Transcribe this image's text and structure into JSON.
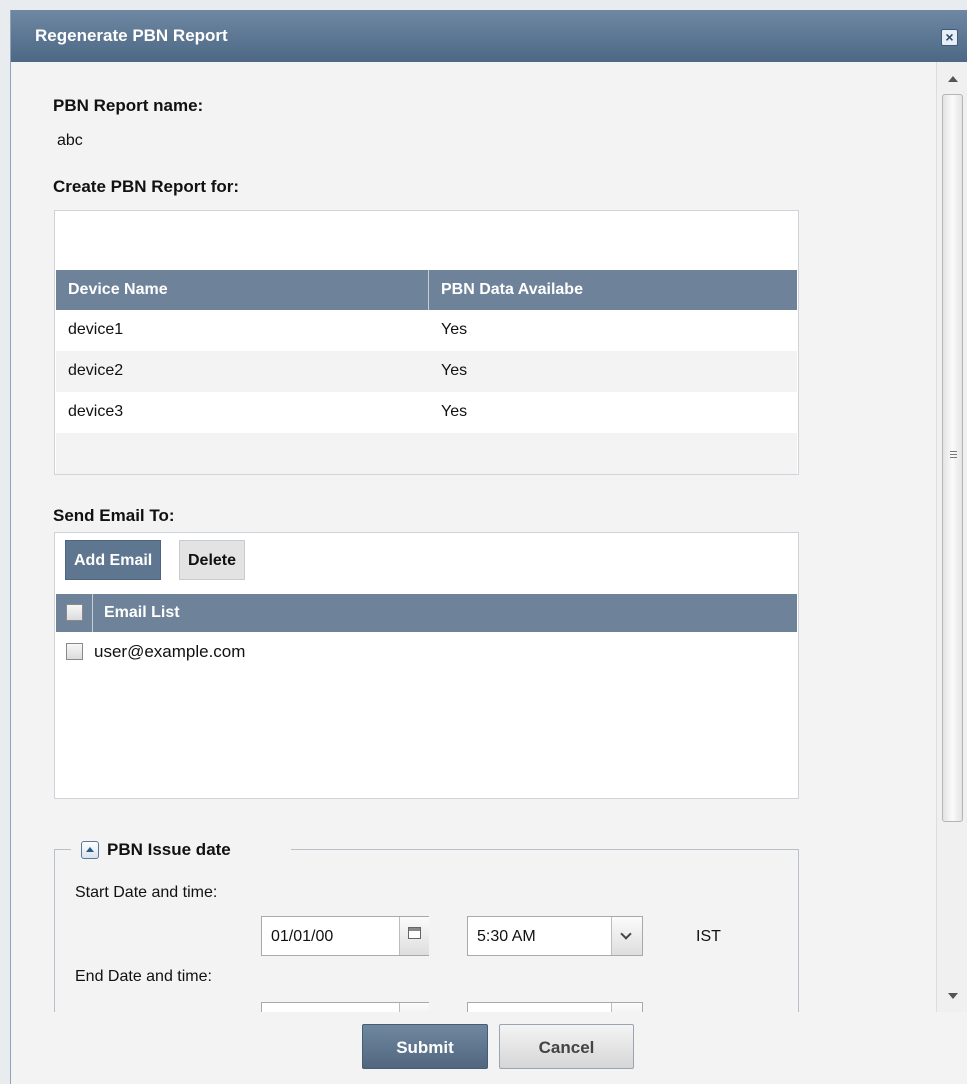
{
  "dialog": {
    "title": "Regenerate PBN Report"
  },
  "report_name": {
    "label": "PBN Report name:",
    "value": "abc"
  },
  "create_for": {
    "label": "Create PBN Report for:",
    "columns": [
      "Device Name",
      "PBN Data Availabe"
    ],
    "rows": [
      [
        "device1",
        "Yes"
      ],
      [
        "device2",
        "Yes"
      ],
      [
        "device3",
        "Yes"
      ]
    ]
  },
  "email": {
    "label": "Send Email To:",
    "add_label": "Add Email",
    "delete_label": "Delete",
    "column": "Email List",
    "rows": [
      "user@example.com"
    ]
  },
  "issue_date": {
    "legend": "PBN Issue date",
    "start_label": "Start Date and time:",
    "start_date": "01/01/00",
    "start_time": "5:30 AM",
    "timezone": "IST",
    "end_label": "End Date and time:"
  },
  "footer": {
    "submit_label": "Submit",
    "cancel_label": "Cancel"
  }
}
